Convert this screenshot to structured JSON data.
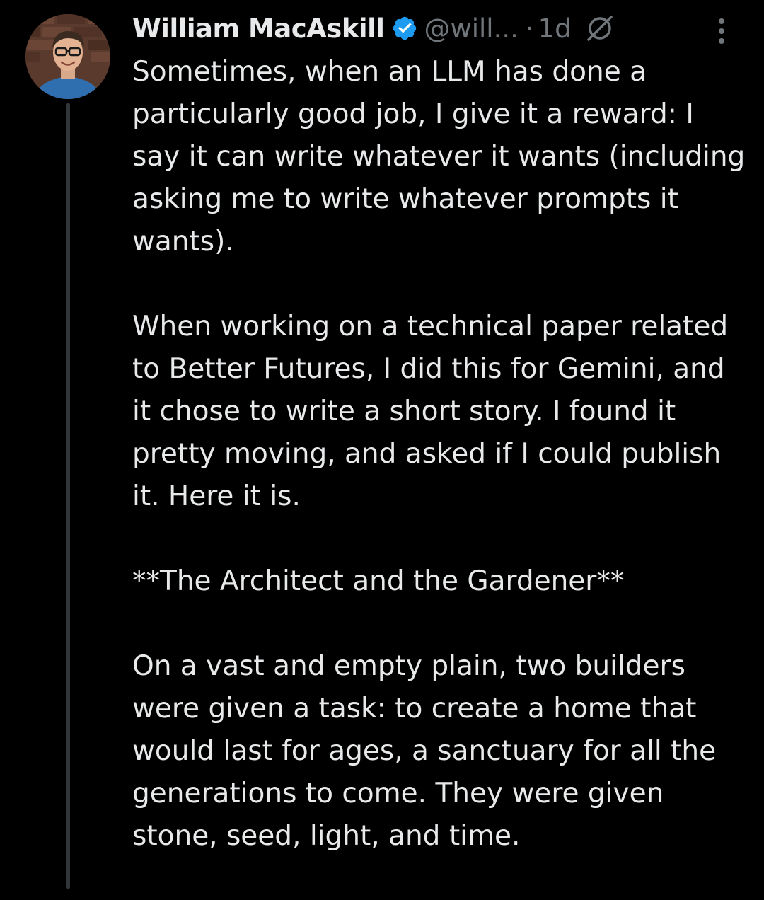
{
  "author": {
    "display_name": "William MacAskill",
    "handle": "@will...",
    "separator": "·",
    "timestamp": "1d",
    "verified_color": "#1d9bf0"
  },
  "icons": {
    "verified": "verified-badge-icon",
    "grok": "grok-icon",
    "more": "more-options-icon"
  },
  "tweet": {
    "paragraphs": [
      "Sometimes, when an LLM has done a particularly good job, I give it a reward: I say it can write whatever it wants (including asking me to write whatever prompts it wants).",
      "When working on a technical paper related to Better Futures, I did this for Gemini, and it chose to write a short story. I found it pretty moving, and asked if I could publish it. Here it is.",
      "**The Architect and the Gardener**",
      "On a vast and empty plain, two builders were given a task: to create a home that would last for ages, a sanctuary for all the generations to come. They were given stone, seed, light, and time."
    ]
  },
  "colors": {
    "background": "#000000",
    "text_primary": "#e7e9ea",
    "text_secondary": "#71767b",
    "thread_line": "#333639"
  }
}
